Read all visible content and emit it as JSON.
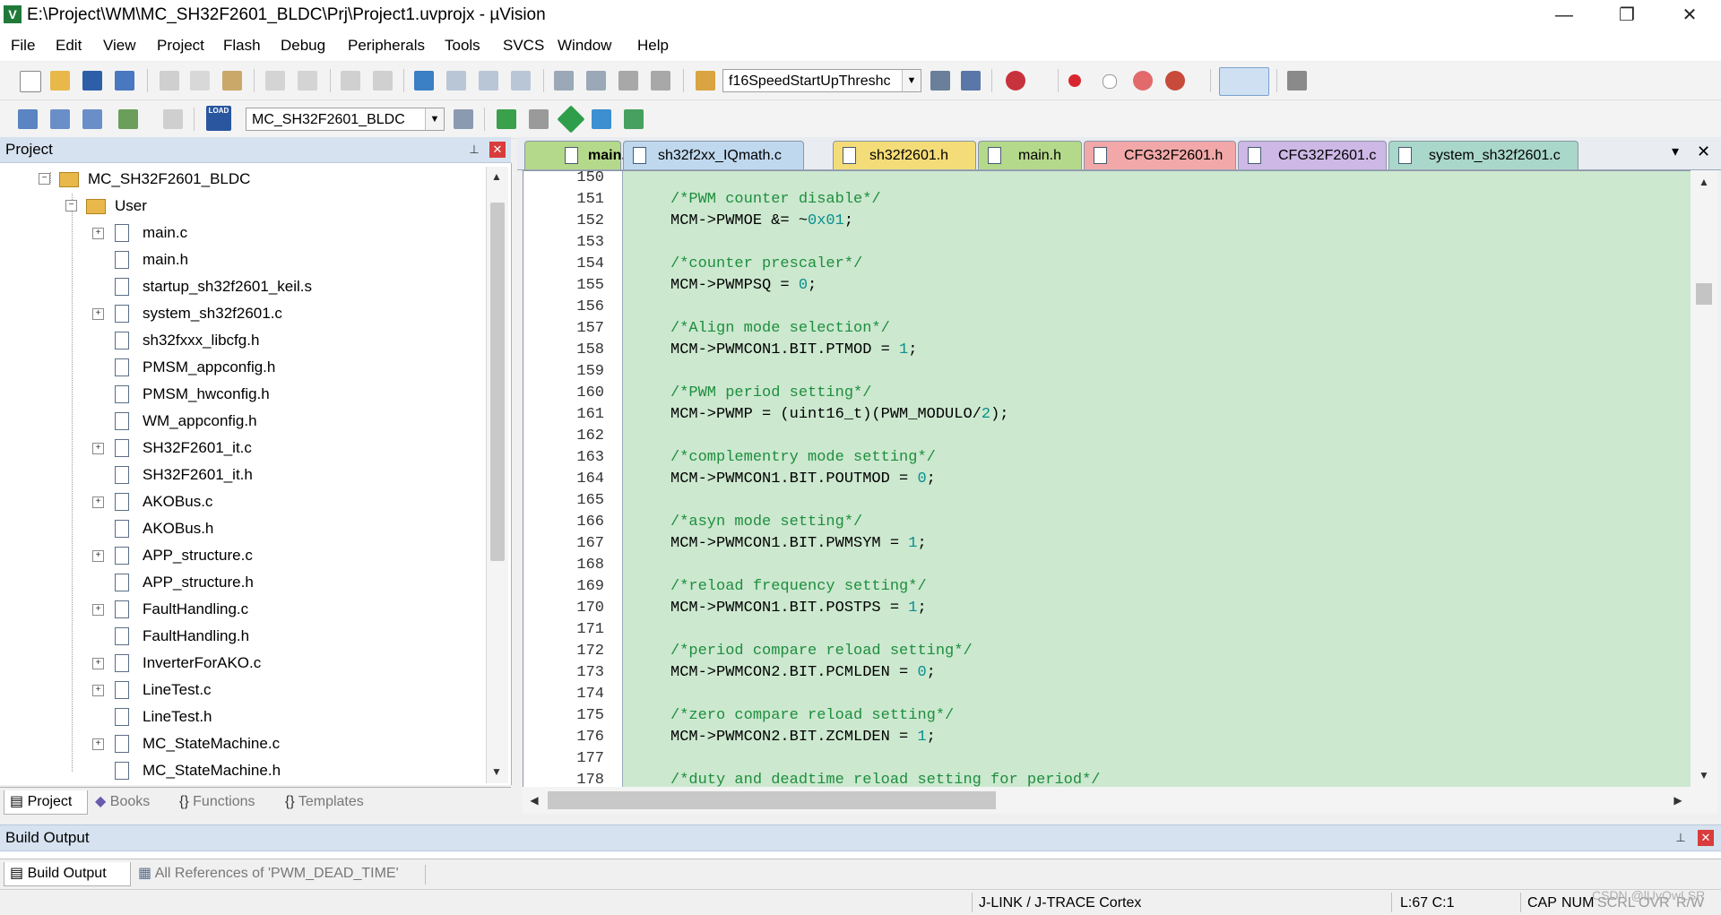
{
  "window": {
    "title": "E:\\Project\\WM\\MC_SH32F2601_BLDC\\Prj\\Project1.uvprojx - µVision",
    "app_icon_glyph": "V",
    "controls": {
      "minimize": "—",
      "restore": "❐",
      "close": "✕"
    }
  },
  "menu": [
    "File",
    "Edit",
    "View",
    "Project",
    "Flash",
    "Debug",
    "Peripherals",
    "Tools",
    "SVCS",
    "Window",
    "Help"
  ],
  "toolbar1": {
    "search_combo_value": "f16SpeedStartUpThreshc",
    "icons": [
      "new-file-icon",
      "open-folder-icon",
      "save-icon",
      "save-all-icon",
      "cut-icon",
      "copy-icon",
      "paste-icon",
      "undo-icon",
      "redo-icon",
      "nav-back-icon",
      "nav-forward-icon",
      "bookmark-set-icon",
      "bookmark-prev-icon",
      "bookmark-next-icon",
      "bookmark-clear-icon",
      "indent-icon",
      "unindent-icon",
      "comment-icon",
      "uncomment-icon",
      "find-in-files-icon",
      "find-icon",
      "incremental-find-icon",
      "debug-start-icon",
      "breakpoint-insert-icon",
      "breakpoint-disable-icon",
      "breakpoint-disable-all-icon",
      "breakpoint-kill-all-icon",
      "window-layout-icon",
      "configure-icon"
    ]
  },
  "toolbar2": {
    "target_combo_value": "MC_SH32F2601_BLDC",
    "load_label": "LOAD",
    "icons": [
      "translate-icon",
      "build-icon",
      "rebuild-icon",
      "batch-build-icon",
      "stop-build-icon",
      "download-icon",
      "target-options-icon",
      "manage-components-icon",
      "select-pack-icon",
      "pack-installer-icon",
      "environment-icon"
    ]
  },
  "project_panel": {
    "title": "Project",
    "root": "MC_SH32F2601_BLDC",
    "group": "User",
    "files": [
      {
        "name": "main.c",
        "expandable": true
      },
      {
        "name": "main.h",
        "expandable": false
      },
      {
        "name": "startup_sh32f2601_keil.s",
        "expandable": false
      },
      {
        "name": "system_sh32f2601.c",
        "expandable": true
      },
      {
        "name": "sh32fxxx_libcfg.h",
        "expandable": false
      },
      {
        "name": "PMSM_appconfig.h",
        "expandable": false
      },
      {
        "name": "PMSM_hwconfig.h",
        "expandable": false
      },
      {
        "name": "WM_appconfig.h",
        "expandable": false
      },
      {
        "name": "SH32F2601_it.c",
        "expandable": true
      },
      {
        "name": "SH32F2601_it.h",
        "expandable": false
      },
      {
        "name": "AKOBus.c",
        "expandable": true
      },
      {
        "name": "AKOBus.h",
        "expandable": false
      },
      {
        "name": "APP_structure.c",
        "expandable": true
      },
      {
        "name": "APP_structure.h",
        "expandable": false
      },
      {
        "name": "FaultHandling.c",
        "expandable": true
      },
      {
        "name": "FaultHandling.h",
        "expandable": false
      },
      {
        "name": "InverterForAKO.c",
        "expandable": true
      },
      {
        "name": "LineTest.c",
        "expandable": true
      },
      {
        "name": "LineTest.h",
        "expandable": false
      },
      {
        "name": "MC_StateMachine.c",
        "expandable": true
      },
      {
        "name": "MC_StateMachine.h",
        "expandable": false
      }
    ],
    "tabs": [
      "Project",
      "Books",
      "Functions",
      "Templates"
    ],
    "tab_glyphs": [
      "▤",
      "◆",
      "{}",
      "{}"
    ]
  },
  "editor": {
    "tabs": [
      {
        "label": "main.c",
        "color": "#b5d98a",
        "active": true
      },
      {
        "label": "sh32f2xx_IQmath.c",
        "color": "#bfd8ee",
        "active": false
      },
      {
        "label": "sh32f2601.h",
        "color": "#f4dc78",
        "active": false
      },
      {
        "label": "main.h",
        "color": "#b5d98a",
        "active": false
      },
      {
        "label": "CFG32F2601.h",
        "color": "#f2a8a8",
        "active": false
      },
      {
        "label": "CFG32F2601.c",
        "color": "#cdb8e6",
        "active": false
      },
      {
        "label": "system_sh32f2601.c",
        "color": "#a9d7c9",
        "active": false
      }
    ],
    "tab_menu_glyph": "▾",
    "tab_close_glyph": "✕",
    "lines": [
      {
        "n": "150",
        "code": ""
      },
      {
        "n": "151",
        "code": "/*PWM counter disable*/"
      },
      {
        "n": "152",
        "code": "MCM->PWMOE &= ~0x01;"
      },
      {
        "n": "153",
        "code": ""
      },
      {
        "n": "154",
        "code": "/*counter prescaler*/"
      },
      {
        "n": "155",
        "code": "MCM->PWMPSQ = 0;"
      },
      {
        "n": "156",
        "code": ""
      },
      {
        "n": "157",
        "code": "/*Align mode selection*/"
      },
      {
        "n": "158",
        "code": "MCM->PWMCON1.BIT.PTMOD = 1;"
      },
      {
        "n": "159",
        "code": ""
      },
      {
        "n": "160",
        "code": "/*PWM period setting*/"
      },
      {
        "n": "161",
        "code": "MCM->PWMP = (uint16_t)(PWM_MODULO/2);"
      },
      {
        "n": "162",
        "code": ""
      },
      {
        "n": "163",
        "code": "/*complementry mode setting*/"
      },
      {
        "n": "164",
        "code": "MCM->PWMCON1.BIT.POUTMOD = 0;"
      },
      {
        "n": "165",
        "code": ""
      },
      {
        "n": "166",
        "code": "/*asyn mode setting*/"
      },
      {
        "n": "167",
        "code": "MCM->PWMCON1.BIT.PWMSYM = 1;"
      },
      {
        "n": "168",
        "code": ""
      },
      {
        "n": "169",
        "code": "/*reload frequency setting*/"
      },
      {
        "n": "170",
        "code": "MCM->PWMCON1.BIT.POSTPS = 1;"
      },
      {
        "n": "171",
        "code": ""
      },
      {
        "n": "172",
        "code": "/*period compare reload setting*/"
      },
      {
        "n": "173",
        "code": "MCM->PWMCON2.BIT.PCMLDEN = 0;"
      },
      {
        "n": "174",
        "code": ""
      },
      {
        "n": "175",
        "code": "/*zero compare reload setting*/"
      },
      {
        "n": "176",
        "code": "MCM->PWMCON2.BIT.ZCMLDEN = 1;"
      },
      {
        "n": "177",
        "code": ""
      },
      {
        "n": "178",
        "code": "/*duty and deadtime reload setting for period*/"
      }
    ]
  },
  "build_output": {
    "title": "Build Output",
    "tabs": [
      "Build Output",
      "All References of 'PWM_DEAD_TIME'"
    ]
  },
  "status": {
    "debugger": "J-LINK / J-TRACE Cortex",
    "position": "L:67 C:1",
    "caps": "CAP",
    "num": "NUM",
    "scrl": "SCRL",
    "ovr": "OVR",
    "rw": "R/W",
    "watermark": "CSDN @lUvOwLSR"
  },
  "colors": {
    "editor_bg": "#cce8cf",
    "comment": "#1e8e3e",
    "number": "#0a8f8f",
    "panel_header": "#d6e2ef"
  }
}
